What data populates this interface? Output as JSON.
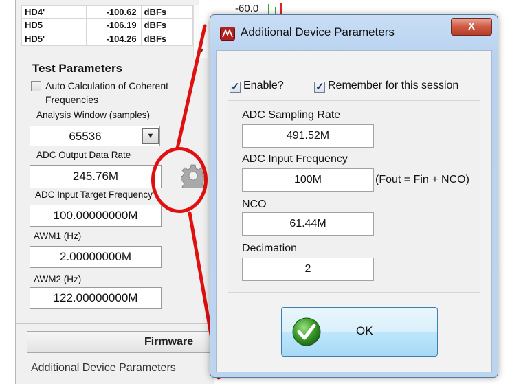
{
  "hd_table": {
    "rows": [
      {
        "name": "HD4'",
        "value": "-100.62",
        "unit": "dBFs"
      },
      {
        "name": "HD5",
        "value": "-106.19",
        "unit": "dBFs"
      },
      {
        "name": "HD5'",
        "value": "-104.26",
        "unit": "dBFs"
      }
    ]
  },
  "test_params": {
    "title": "Test Parameters",
    "auto_calc_label": "Auto Calculation of Coherent Frequencies",
    "analysis_window_label": "Analysis Window (samples)",
    "analysis_window_value": "65536",
    "adc_output_rate_label": "ADC Output Data Rate",
    "adc_output_rate_value": "245.76M",
    "adc_input_target_label": "ADC Input Target Frequency",
    "adc_input_target_value": "100.00000000M",
    "awm1_label": "AWM1 (Hz)",
    "awm1_value": "2.00000000M",
    "awm2_label": "AWM2 (Hz)",
    "awm2_value": "122.00000000M"
  },
  "firmware_button": "Firmware",
  "bottom_label": "Additional Device Parameters",
  "chart": {
    "axis_label": "-60.0"
  },
  "dialog": {
    "title": "Additional Device Parameters",
    "close_label": "X",
    "enable_label": "Enable?",
    "remember_label": "Remember for this session",
    "sampling_rate_label": "ADC Sampling Rate",
    "sampling_rate_value": "491.52M",
    "input_freq_label": "ADC Input  Frequency",
    "input_freq_value": "100M",
    "input_freq_note": "(Fout = Fin + NCO)",
    "nco_label": "NCO",
    "nco_value": "61.44M",
    "decimation_label": "Decimation",
    "decimation_value": "2",
    "ok_label": "OK"
  },
  "colors": {
    "annotation_red": "#e01010",
    "dialog_frame": "#bcd5ef",
    "ok_check_green": "#3c9a2c"
  }
}
